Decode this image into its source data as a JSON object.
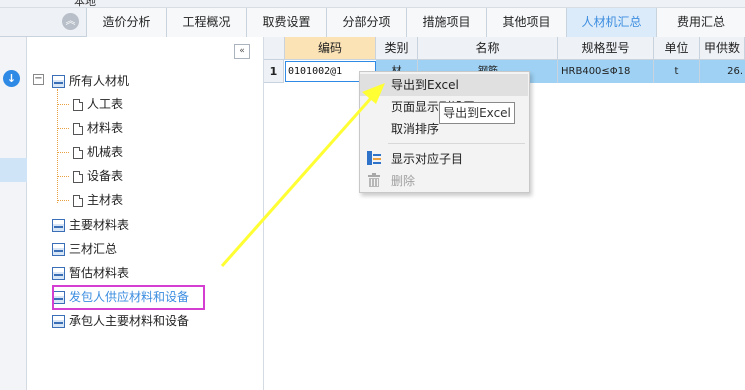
{
  "top_strip": {
    "text": "本地"
  },
  "tabs": [
    {
      "label": "造价分析"
    },
    {
      "label": "工程概况"
    },
    {
      "label": "取费设置"
    },
    {
      "label": "分部分项"
    },
    {
      "label": "措施项目"
    },
    {
      "label": "其他项目"
    },
    {
      "label": "人材机汇总"
    },
    {
      "label": "费用汇总"
    }
  ],
  "active_tab": "人材机汇总",
  "tree": {
    "collapse_label": "«",
    "expander_label": "−",
    "root": "所有人材机",
    "children": [
      "人工表",
      "材料表",
      "机械表",
      "设备表",
      "主材表"
    ],
    "others": [
      "主要材料表",
      "三材汇总",
      "暂估材料表",
      "发包人供应材料和设备",
      "承包人主要材料和设备"
    ]
  },
  "grid": {
    "headers": [
      "编码",
      "类别",
      "名称",
      "规格型号",
      "单位",
      "甲供数"
    ],
    "row": {
      "num": "1",
      "code": "0101002@1",
      "category": "材",
      "name": "钢筋",
      "spec": "HRB400≤Φ18",
      "unit": "t",
      "qty": "26."
    }
  },
  "context_menu": {
    "items": [
      "导出到Excel",
      "页面显示列设置",
      "取消排序",
      "显示对应子目",
      "删除"
    ]
  },
  "tooltip": "导出到Excel",
  "colors": {
    "accent": "#2f8ae5",
    "active_tab_text": "#3d8ee0",
    "selected_row": "#9ed1f3",
    "highlight_box": "#d43fd1",
    "arrow": "#ffff33"
  }
}
